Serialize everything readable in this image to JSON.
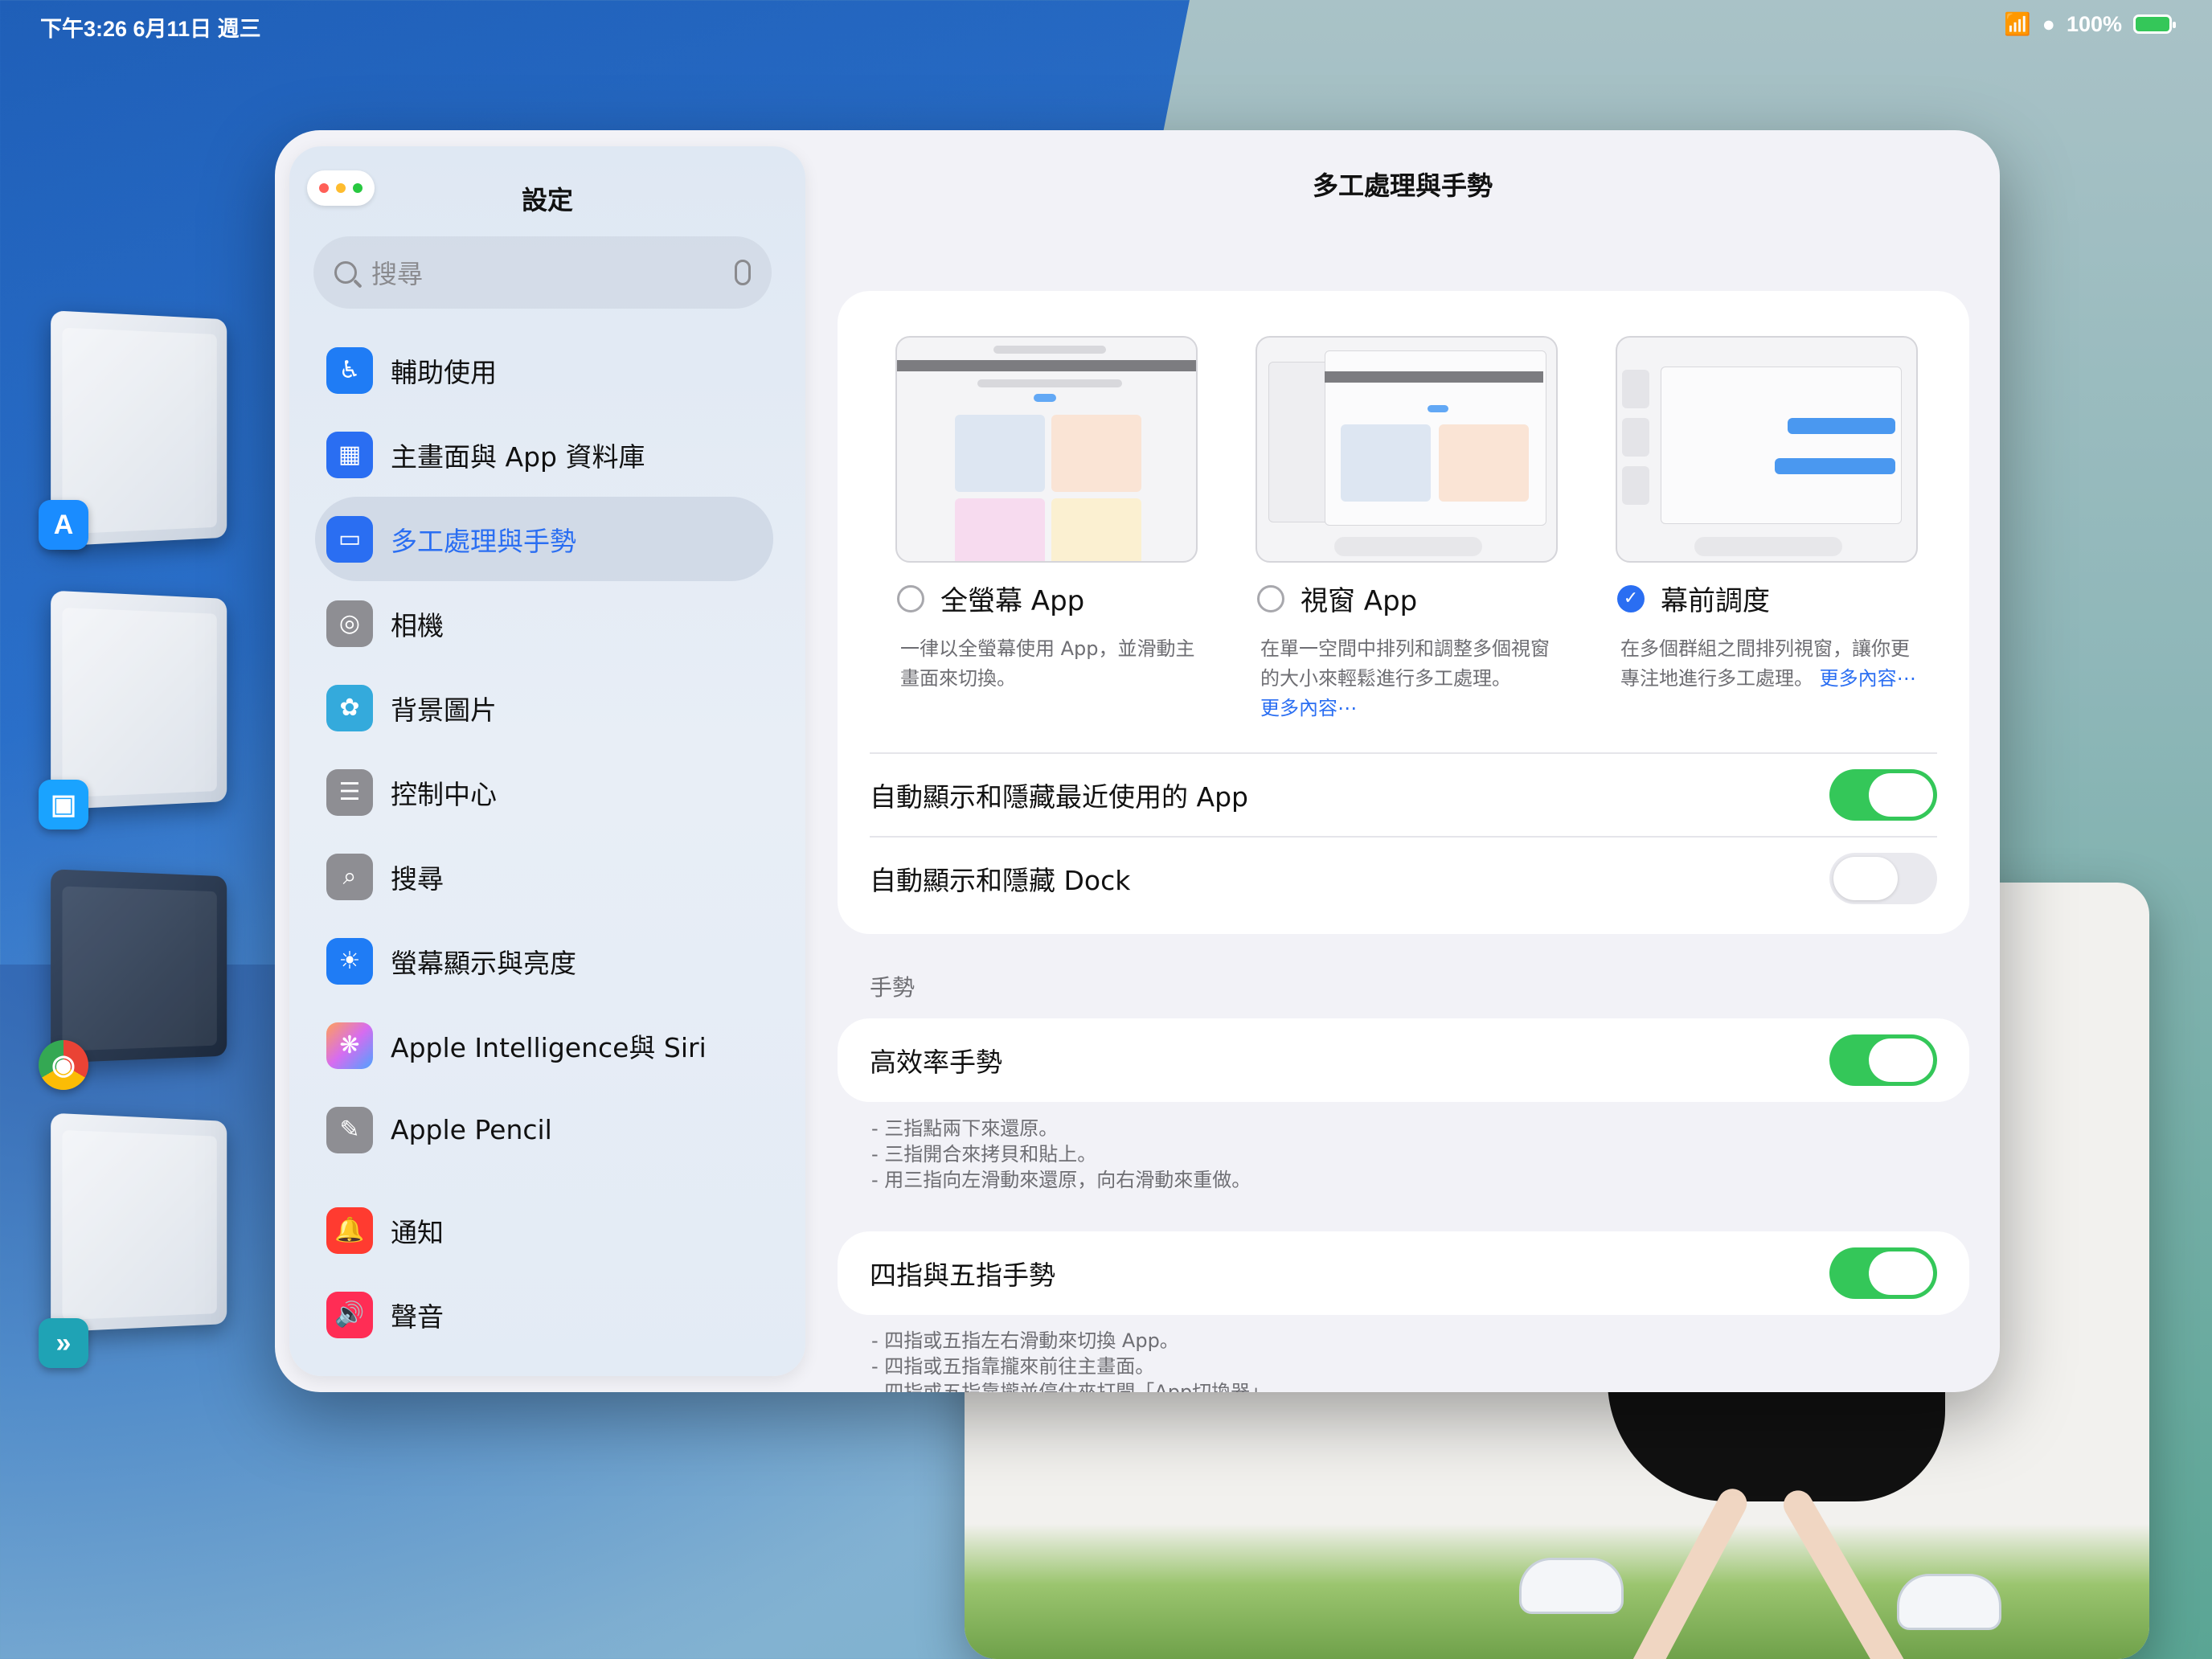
{
  "status_bar": {
    "time_date": "下午3:26   6月11日 週三",
    "battery_percent": "100%"
  },
  "sidebar": {
    "title": "設定",
    "search_placeholder": "搜尋",
    "items": [
      {
        "label": "輔助使用",
        "icon": "accessibility-icon",
        "color": "#1f7cf5"
      },
      {
        "label": "主畫面與 App 資料庫",
        "icon": "home-screen-icon",
        "color": "#2a6ef2"
      },
      {
        "label": "多工處理與手勢",
        "icon": "multitasking-icon",
        "color": "#2a6ef2",
        "active": true
      },
      {
        "label": "相機",
        "icon": "camera-icon",
        "color": "#8e8e93"
      },
      {
        "label": "背景圖片",
        "icon": "wallpaper-icon",
        "color": "#34aadc"
      },
      {
        "label": "控制中心",
        "icon": "control-center-icon",
        "color": "#8e8e93"
      },
      {
        "label": "搜尋",
        "icon": "search-icon",
        "color": "#8e8e93"
      },
      {
        "label": "螢幕顯示與亮度",
        "icon": "brightness-icon",
        "color": "#1f7cf5"
      },
      {
        "label": "Apple Intelligence與 Siri",
        "icon": "apple-intelligence-icon",
        "color": "#ff9f5a"
      },
      {
        "label": "Apple Pencil",
        "icon": "pencil-icon",
        "color": "#8e8e93"
      },
      {
        "label": "通知",
        "icon": "notifications-icon",
        "color": "#ff3b30"
      },
      {
        "label": "聲音",
        "icon": "sound-icon",
        "color": "#ff2d55"
      }
    ]
  },
  "main": {
    "title": "多工處理與手勢",
    "options": [
      {
        "label": "全螢幕 App",
        "selected": false,
        "desc": "一律以全螢幕使用 App，並滑動主畫面來切換。",
        "more": ""
      },
      {
        "label": "視窗 App",
        "selected": false,
        "desc": "在單一空間中排列和調整多個視窗的大小來輕鬆進行多工處理。",
        "more": "更多內容⋯"
      },
      {
        "label": "幕前調度",
        "selected": true,
        "desc": "在多個群組之間排列視窗，讓你更專注地進行多工處理。",
        "more": "更多內容⋯"
      }
    ],
    "toggles": {
      "recent_apps": {
        "label": "自動顯示和隱藏最近使用的 App",
        "on": true
      },
      "dock": {
        "label": "自動顯示和隱藏 Dock",
        "on": false
      }
    },
    "gestures_header": "手勢",
    "efficient_gestures": {
      "label": "高效率手勢",
      "on": true
    },
    "efficient_notes": [
      "- 三指點兩下來還原。",
      "- 三指開合來拷貝和貼上。",
      "- 用三指向左滑動來還原，向右滑動來重做。"
    ],
    "four_five": {
      "label": "四指與五指手勢",
      "on": true
    },
    "four_five_notes": [
      "- 四指或五指左右滑動來切換 App。",
      "- 四指或五指靠攏來前往主畫面。",
      "- 四指或五指靠攏並停住來打開「App切換器」。"
    ]
  }
}
